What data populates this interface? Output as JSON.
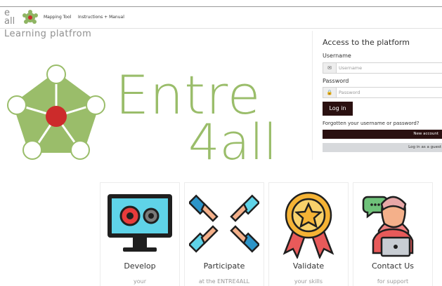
{
  "header": {
    "brand_text": "e\nall",
    "nav": [
      "Mapping Tool",
      "Instructions + Manual"
    ],
    "nav_joined": "Mapping Tool  Instructions + Manual"
  },
  "site": {
    "title": "Learning platfrom"
  },
  "hero": {
    "word1": "Entre",
    "word2": "4all",
    "color": "#9abd6a"
  },
  "login": {
    "heading": "Access to the platform",
    "username_label": "Username",
    "username_placeholder": "Username",
    "password_label": "Password",
    "password_placeholder": "Password",
    "login_button": "Log in",
    "forgot": "Forgotten your username or password?",
    "new_account": "New account",
    "guest": "Log in as a guest"
  },
  "cards": [
    {
      "title": "Develop",
      "sub": "your",
      "icon": "computer-gears-icon"
    },
    {
      "title": "Participate",
      "sub": "at the ENTRE4ALL",
      "icon": "hands-teamwork-icon"
    },
    {
      "title": "Validate",
      "sub": "your skills",
      "icon": "medal-badge-icon"
    },
    {
      "title": "Contact Us",
      "sub": "for support",
      "icon": "support-agent-icon"
    }
  ],
  "colors": {
    "brand_green": "#9abd6a",
    "brand_red": "#cc2b2b",
    "button_dark": "#2a1010"
  }
}
